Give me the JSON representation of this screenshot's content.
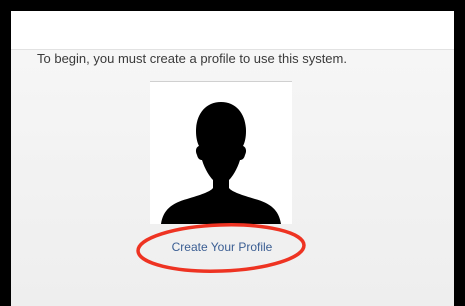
{
  "intro": {
    "text": "To begin, you must create a profile to use this system."
  },
  "profile": {
    "avatar_icon": "person-silhouette-icon",
    "create_link_label": "Create Your Profile"
  },
  "annotation": {
    "highlight_color": "#ee3322"
  },
  "colors": {
    "link": "#3b5e93",
    "text": "#3a3a3a",
    "frame": "#000000"
  }
}
